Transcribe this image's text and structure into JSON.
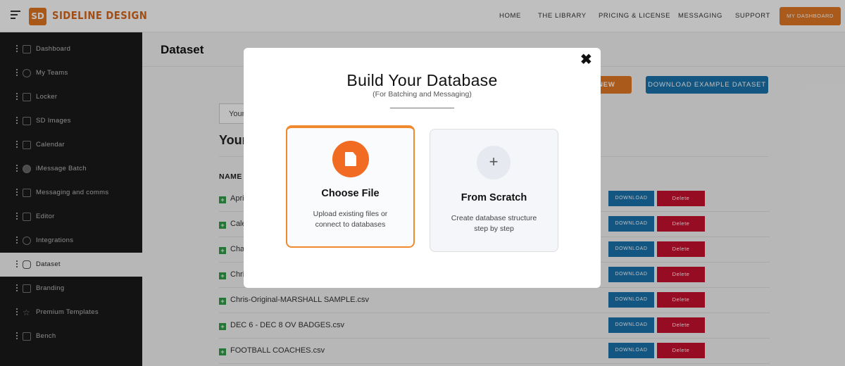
{
  "topnav": {
    "logo_mark": "SD",
    "logo_text": "SIDELINE DESIGN",
    "links": [
      "HOME",
      "THE LIBRARY",
      "PRICING & LICENSE",
      "MESSAGING",
      "SUPPORT"
    ],
    "dashboard_button": "MY DASHBOARD"
  },
  "sidebar": {
    "items": [
      {
        "label": "Dashboard",
        "icon": "dashboard-icon"
      },
      {
        "label": "My Teams",
        "icon": "user-icon"
      },
      {
        "label": "Locker",
        "icon": "locker-icon"
      },
      {
        "label": "SD Images",
        "icon": "images-icon"
      },
      {
        "label": "Calendar",
        "icon": "calendar-icon"
      },
      {
        "label": "iMessage Batch",
        "icon": "imessage-icon"
      },
      {
        "label": "Messaging and comms",
        "icon": "chat-icon"
      },
      {
        "label": "Editor",
        "icon": "edit-icon"
      },
      {
        "label": "Integrations",
        "icon": "integrations-icon"
      },
      {
        "label": "Dataset",
        "icon": "database-icon"
      },
      {
        "label": "Branding",
        "icon": "branding-icon"
      },
      {
        "label": "Premium Templates",
        "icon": "star-icon"
      },
      {
        "label": "Bench",
        "icon": "bench-icon"
      }
    ],
    "active": "Dataset"
  },
  "main": {
    "title": "Dataset",
    "add_new_label": "D NEW",
    "download_example_label": "DOWNLOAD EXAMPLE DATASET",
    "search_value": "Your",
    "section_title": "Your",
    "name_header": "NAME",
    "rows": [
      {
        "name": "April"
      },
      {
        "name": "Cale"
      },
      {
        "name": "Cha"
      },
      {
        "name": "Chris"
      },
      {
        "name": "Chris-Original-MARSHALL SAMPLE.csv"
      },
      {
        "name": "DEC 6 - DEC 8 OV BADGES.csv"
      },
      {
        "name": "FOOTBALL COACHES.csv"
      }
    ],
    "download_label": "DOWNLOAD",
    "delete_label": "Delete"
  },
  "modal": {
    "close": "✖",
    "title": "Build Your Database",
    "subtitle": "(For Batching and Messaging)",
    "options": [
      {
        "title": "Choose File",
        "desc_line1": "Upload existing files or",
        "desc_line2": "connect to databases",
        "icon": "file-icon"
      },
      {
        "title": "From Scratch",
        "desc_line1": "Create database structure",
        "desc_line2": "step by step",
        "icon": "plus-icon"
      }
    ]
  },
  "colors": {
    "accent_orange": "#e37a24",
    "primary_blue": "#1a73ae",
    "delete_red": "#c8102e",
    "sidebar_bg": "#1a1a1a"
  }
}
